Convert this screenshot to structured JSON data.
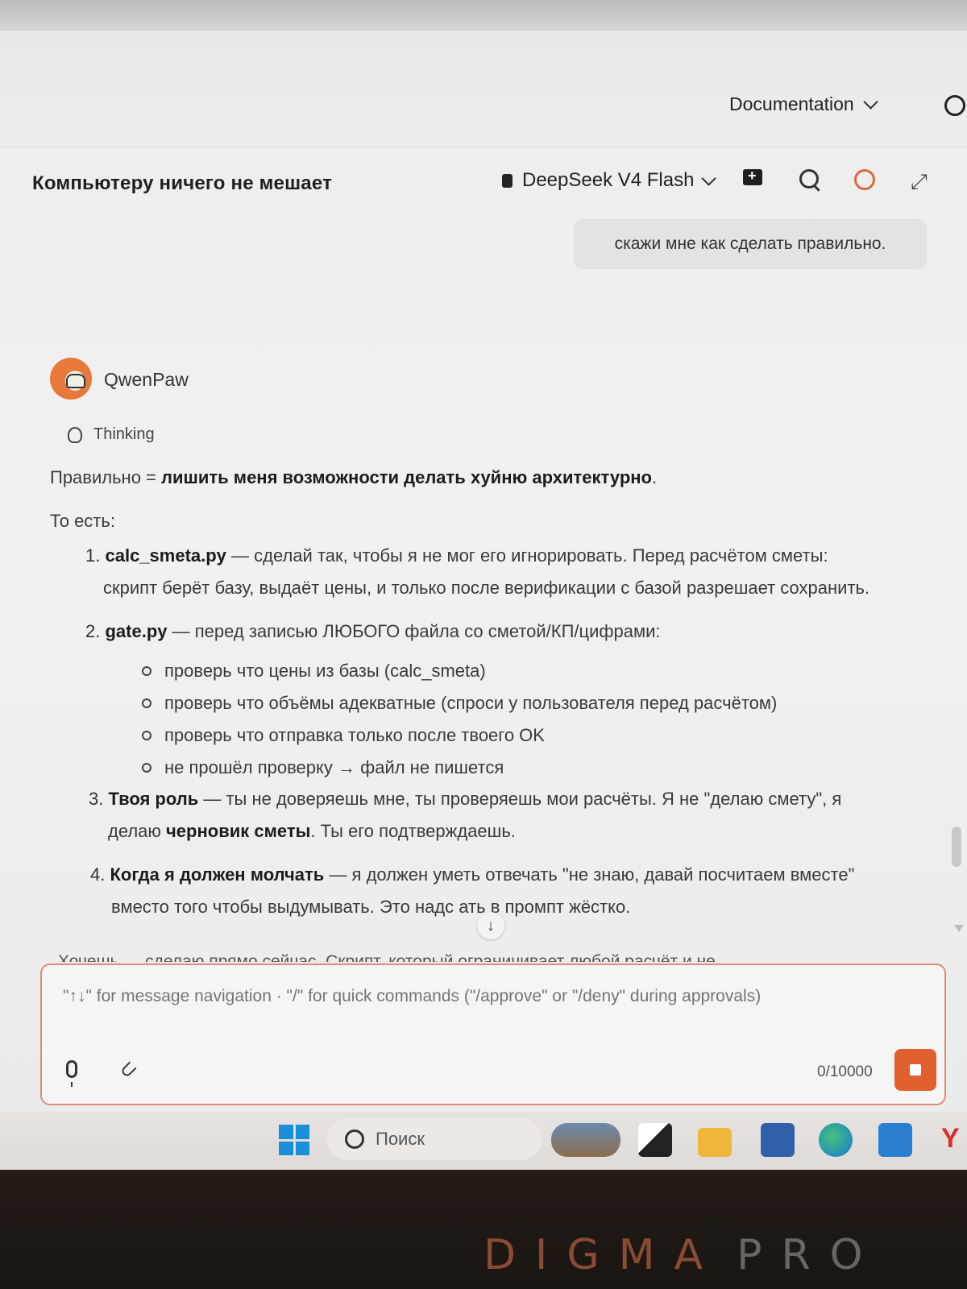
{
  "header": {
    "documentation_label": "Documentation",
    "github_icon": "github-icon"
  },
  "chat": {
    "title": "Компьютеру ничего не мешает",
    "model": "DeepSeek V4 Flash",
    "user_message": "скажи мне как сделать правильно.",
    "assistant": {
      "name": "QwenPaw",
      "thinking_label": "Thinking",
      "p1_prefix": "Правильно = ",
      "p1_bold": "лишить меня возможности делать хуйню архитектурно",
      "p1_suffix": ".",
      "p2": "То есть:",
      "items": [
        {
          "num": "1.",
          "bold": "calc_smeta.py",
          "text": " — сделай так, чтобы я не мог его игнорировать. Перед расчётом сметы:",
          "line2": "скрипт берёт базу, выдаёт цены, и только после верификации с базой разрешает сохранить."
        },
        {
          "num": "2.",
          "bold": "gate.py",
          "text": " — перед записью ЛЮБОГО файла со сметой/КП/цифрами:",
          "subitems": [
            "проверь что цены из базы (calc_smeta)",
            "проверь что объёмы адекватные (спроси у пользователя перед расчётом)",
            "проверь что отправка только после твоего OK",
            "не прошёл проверку → файл не пишется"
          ]
        },
        {
          "num": "3.",
          "bold": "Твоя роль",
          "text": " — ты не доверяешь мне, ты проверяешь мои расчёты. Я не \"делаю смету\", я",
          "line2_prefix": "делаю ",
          "line2_bold": "черновик сметы",
          "line2_suffix": ". Ты его подтверждаешь."
        },
        {
          "num": "4.",
          "bold": "Когда я должен молчать",
          "text": " — я должен уметь отвечать \"не знаю, давай посчитаем вместе\"",
          "line2": "вместо того чтобы выдумывать. Это надс      ать в промпт жёстко."
        }
      ],
      "cut_line": "Хочешь — сделаю              прямо сейчас. Скрипт, который ограничивает любой расчёт и не"
    }
  },
  "composer": {
    "placeholder": "\"↑↓\" for message navigation · \"/\" for quick commands (\"/approve\" or \"/deny\" during approvals)",
    "counter": "0/10000"
  },
  "taskbar": {
    "search_label": "Поиск"
  },
  "device": {
    "brand": "DIGMA",
    "brand_suffix": "PRO"
  },
  "colors": {
    "accent": "#e0602e",
    "composer_border": "#e08a7a"
  }
}
